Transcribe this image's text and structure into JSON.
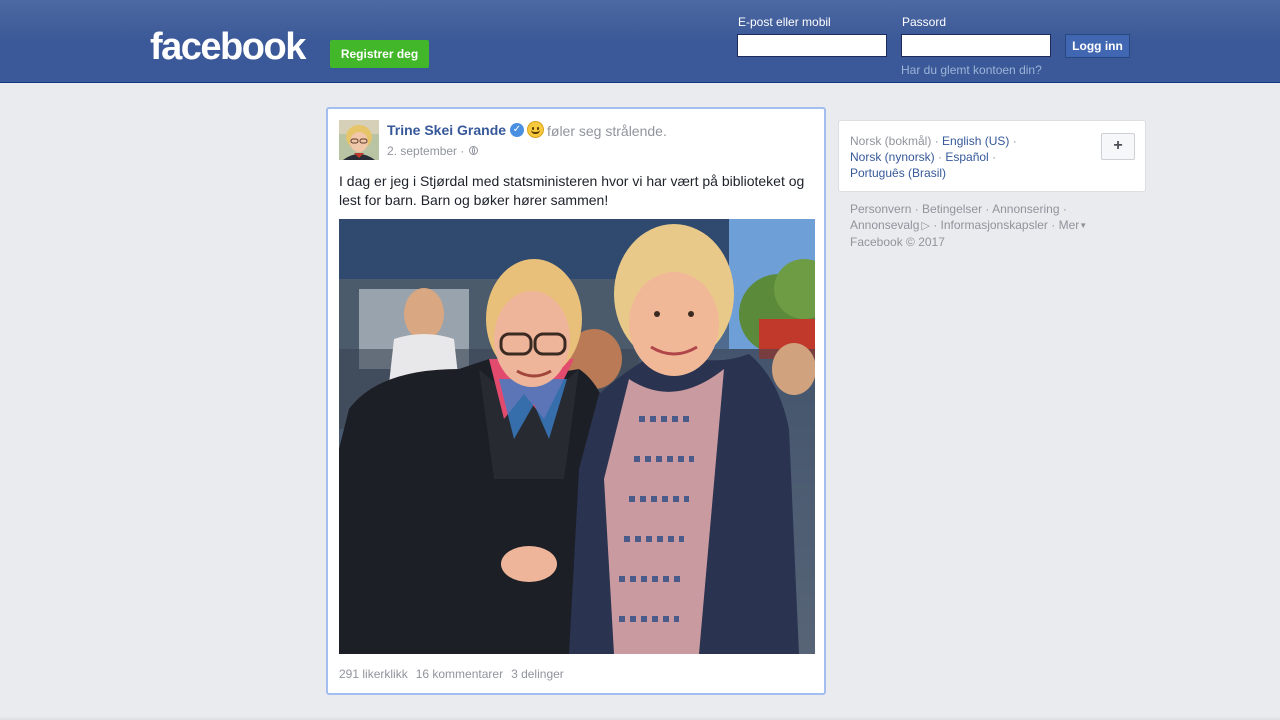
{
  "header": {
    "logo": "facebook",
    "signup_button": "Registrer deg",
    "email_label": "E-post eller mobil",
    "password_label": "Passord",
    "email_value": "",
    "password_value": "",
    "login_button": "Logg inn",
    "forgot_link": "Har du glemt kontoen din?"
  },
  "post": {
    "author": "Trine Skei Grande",
    "feeling": "føler seg strålende.",
    "date": "2. september ·",
    "text": "I dag er jeg i Stjørdal med statsministeren hvor vi har vært på biblioteket og lest for barn. Barn og bøker hører sammen!",
    "likes": "291 likerklikk",
    "comments": "16 kommentarer",
    "shares": "3 delinger"
  },
  "languages": {
    "current": "Norsk (bokmål)",
    "options": [
      "English (US)",
      "Norsk (nynorsk)",
      "Español",
      "Português (Brasil)"
    ],
    "add_button": "+"
  },
  "footer": {
    "links": [
      "Personvern",
      "Betingelser",
      "Annonsering",
      "Annonsevalg",
      "Informasjonskapsler",
      "Mer"
    ],
    "copyright": "Facebook © 2017"
  },
  "icons": {
    "verified": "verified-badge-icon",
    "feeling": "smiley-icon",
    "audience": "globe-icon",
    "adchoices": "adchoices-icon"
  },
  "colors": {
    "header_blue": "#3b5998",
    "signup_green": "#42b72a",
    "link_blue": "#365899",
    "muted_gray": "#90949c"
  }
}
